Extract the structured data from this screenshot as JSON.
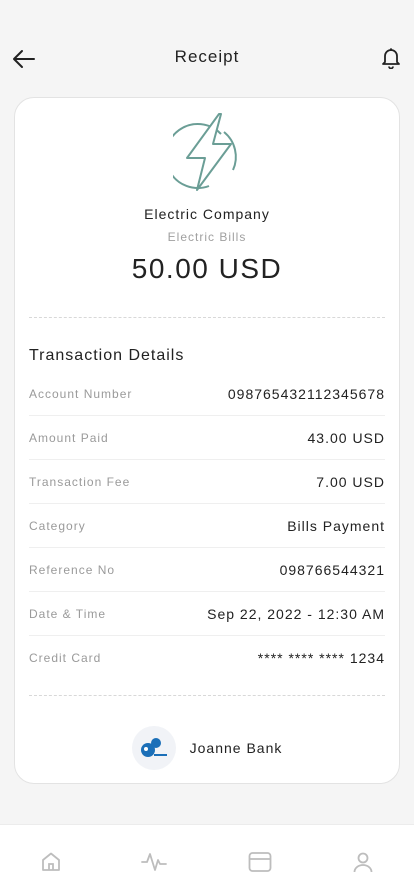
{
  "header": {
    "title": "Receipt",
    "back_icon": "arrow-left-icon",
    "bell_icon": "bell-icon"
  },
  "receipt": {
    "company": "Electric Company",
    "category": "Electric Bills",
    "amount": "50.00 USD",
    "logo_icon": "lightning-bolt-icon",
    "accent_color": "#6b9e96"
  },
  "details": {
    "title": "Transaction Details",
    "rows": [
      {
        "label": "Account Number",
        "value": "098765432112345678"
      },
      {
        "label": "Amount Paid",
        "value": "43.00 USD"
      },
      {
        "label": "Transaction Fee",
        "value": "7.00 USD"
      },
      {
        "label": "Category",
        "value": "Bills Payment"
      },
      {
        "label": "Reference No",
        "value": "098766544321"
      },
      {
        "label": "Date & Time",
        "value": "Sep 22, 2022 - 12:30 AM"
      },
      {
        "label": "Credit Card",
        "value": "**** **** **** 1234"
      }
    ]
  },
  "bank": {
    "name": "Joanne Bank",
    "logo_icon": "bank-logo-icon",
    "brand_color": "#1b6fb8"
  },
  "bottom_nav": {
    "items": [
      {
        "icon": "home-icon"
      },
      {
        "icon": "activity-icon"
      },
      {
        "icon": "card-icon"
      },
      {
        "icon": "profile-icon"
      }
    ]
  }
}
